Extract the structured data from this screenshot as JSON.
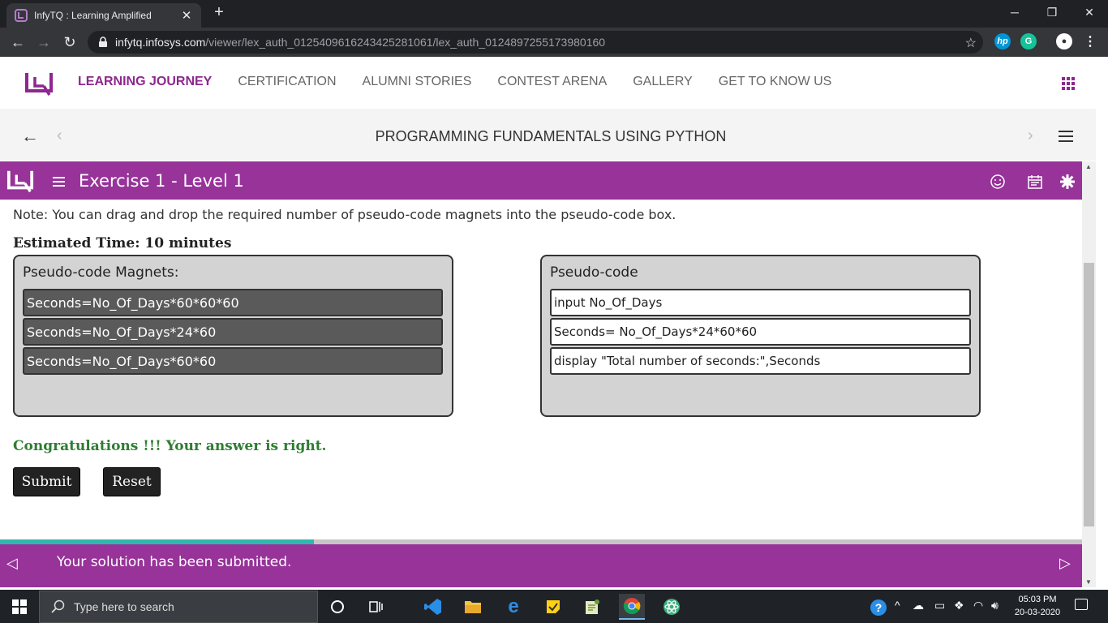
{
  "browser": {
    "tab_title": "InfyTQ : Learning Amplified",
    "tab_close": "✕",
    "new_tab": "+",
    "url_host": "infytq.infosys.com",
    "url_path": "/viewer/lex_auth_012540961624342528106​1/lex_auth_0124897255173980160",
    "window_minimize": "─",
    "window_restore": "❐",
    "window_close": "✕"
  },
  "site": {
    "nav": [
      {
        "label": "LEARNING JOURNEY"
      },
      {
        "label": "CERTIFICATION"
      },
      {
        "label": "ALUMNI STORIES"
      },
      {
        "label": "CONTEST ARENA"
      },
      {
        "label": "GALLERY"
      },
      {
        "label": "GET TO KNOW US"
      }
    ],
    "accent": "#8e278f"
  },
  "course": {
    "title": "PROGRAMMING FUNDAMENTALS USING PYTHON"
  },
  "exercise": {
    "title": "Exercise 1 - Level 1",
    "note": "Note: You can drag and drop the required number of pseudo-code magnets into the pseudo-code box.",
    "estimated_time": "Estimated Time: 10 minutes",
    "magnets_title": "Pseudo-code Magnets:",
    "magnets": [
      "Seconds=No_Of_Days*60*60*60",
      "Seconds=No_Of_Days*24*60",
      "Seconds=No_Of_Days*60*60"
    ],
    "pseudocode_title": "Pseudo-code",
    "pseudocode": [
      "input No_Of_Days",
      "Seconds= No_Of_Days*24*60*60",
      "display \"Total number of seconds:\",Seconds"
    ],
    "result": "Congratulations !!! Your answer is right.",
    "submit_label": "Submit",
    "reset_label": "Reset",
    "header_color": "#973399",
    "success_color": "#2e7d32"
  },
  "footer": {
    "message": "Your solution has been submitted.",
    "progress_fraction": 0.29
  },
  "taskbar": {
    "search_placeholder": "Type here to search",
    "time": "05:03 PM",
    "date": "20-03-2020"
  }
}
